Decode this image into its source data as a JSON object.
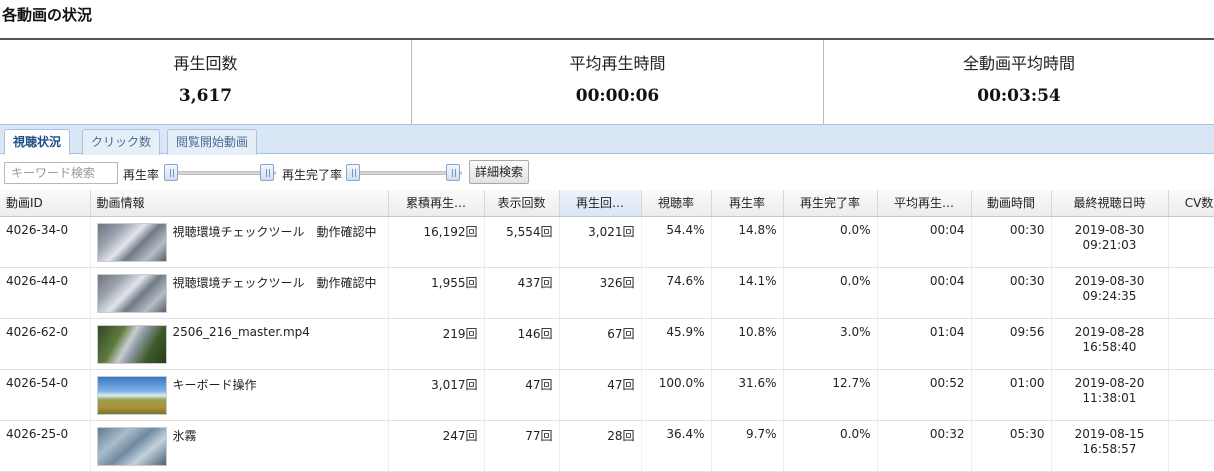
{
  "page": {
    "title": "各動画の状況"
  },
  "summary": [
    {
      "label": "再生回数",
      "value": "3,617"
    },
    {
      "label": "平均再生時間",
      "value": "00:00:06"
    },
    {
      "label": "全動画平均時間",
      "value": "00:03:54"
    }
  ],
  "tabs": [
    {
      "label": "視聴状況",
      "active": true
    },
    {
      "label": "クリック数",
      "active": false
    },
    {
      "label": "閲覧開始動画",
      "active": false
    }
  ],
  "filters": {
    "search_placeholder": "キーワード検索",
    "playrate_label": "再生率",
    "completion_label": "再生完了率",
    "detail_button": "詳細検索"
  },
  "table": {
    "columns": [
      "動画ID",
      "動画情報",
      "累積再生…",
      "表示回数",
      "再生回…",
      "視聴率",
      "再生率",
      "再生完了率",
      "平均再生…",
      "動画時間",
      "最終視聴日時",
      "CV数"
    ],
    "rows": [
      {
        "id": "4026-34-0",
        "thumb": "t-bird",
        "title": "視聴環境チェックツール　動作確認中",
        "total": "16,192回",
        "views": "5,554回",
        "plays": "3,021回",
        "watch_rate": "54.4%",
        "play_rate": "14.8%",
        "complete_rate": "0.0%",
        "avg": "00:04",
        "duration": "00:30",
        "date": "2019-08-30",
        "time": "09:21:03"
      },
      {
        "id": "4026-44-0",
        "thumb": "t-bird",
        "title": "視聴環境チェックツール　動作確認中",
        "total": "1,955回",
        "views": "437回",
        "plays": "326回",
        "watch_rate": "74.6%",
        "play_rate": "14.1%",
        "complete_rate": "0.0%",
        "avg": "00:04",
        "duration": "00:30",
        "date": "2019-08-30",
        "time": "09:24:35"
      },
      {
        "id": "4026-62-0",
        "thumb": "t-statue",
        "title": "2506_216_master.mp4",
        "total": "219回",
        "views": "146回",
        "plays": "67回",
        "watch_rate": "45.9%",
        "play_rate": "10.8%",
        "complete_rate": "3.0%",
        "avg": "01:04",
        "duration": "09:56",
        "date": "2019-08-28",
        "time": "16:58:40"
      },
      {
        "id": "4026-54-0",
        "thumb": "t-field",
        "title": "キーボード操作",
        "total": "3,017回",
        "views": "47回",
        "plays": "47回",
        "watch_rate": "100.0%",
        "play_rate": "31.6%",
        "complete_rate": "12.7%",
        "avg": "00:52",
        "duration": "01:00",
        "date": "2019-08-20",
        "time": "11:38:01"
      },
      {
        "id": "4026-25-0",
        "thumb": "t-ice",
        "title": "氷霧",
        "total": "247回",
        "views": "77回",
        "plays": "28回",
        "watch_rate": "36.4%",
        "play_rate": "9.7%",
        "complete_rate": "0.0%",
        "avg": "00:32",
        "duration": "05:30",
        "date": "2019-08-15",
        "time": "16:58:57"
      }
    ]
  },
  "colors": {
    "tab_bar": "#d9e6f5",
    "rate_red": "#d9482b",
    "rate_green": "#2ea02e"
  }
}
